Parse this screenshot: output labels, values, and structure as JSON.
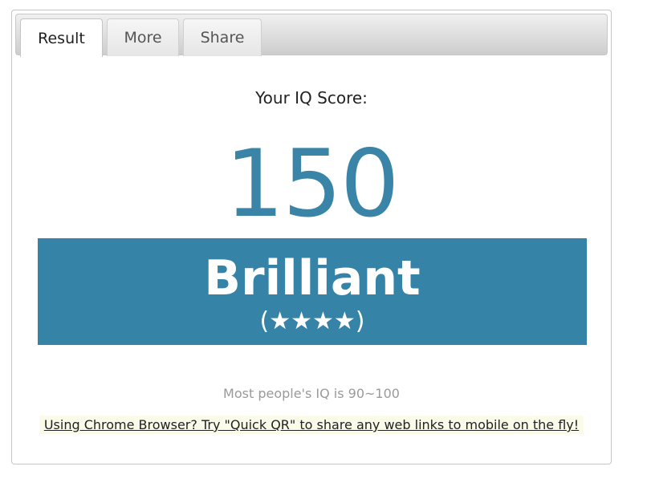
{
  "tabs": [
    {
      "label": "Result",
      "active": true
    },
    {
      "label": "More",
      "active": false
    },
    {
      "label": "Share",
      "active": false
    }
  ],
  "result": {
    "score_label": "Your IQ Score:",
    "score": "150",
    "rating": "Brilliant",
    "stars": "(★★★★)",
    "common_note": "Most people's IQ is 90~100",
    "promo_link": "Using Chrome Browser? Try \"Quick QR\" to share any web links to mobile on the fly!"
  },
  "colors": {
    "accent": "#3683a8",
    "promo_background": "#fbfbe9"
  }
}
